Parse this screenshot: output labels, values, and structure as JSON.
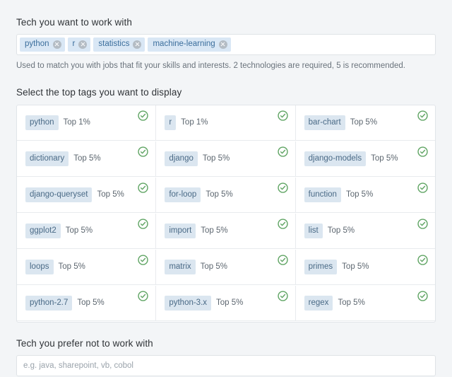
{
  "work_with": {
    "title": "Tech you want to work with",
    "pills": [
      "python",
      "r",
      "statistics",
      "machine-learning"
    ],
    "helper": "Used to match you with jobs that fit your skills and interests. 2 technologies are required, 5 is recommended."
  },
  "top_tags": {
    "title": "Select the top tags you want to display",
    "checkmark_color": "#5fa463",
    "cells": [
      {
        "tag": "python",
        "rank": "Top 1%",
        "selected": true
      },
      {
        "tag": "r",
        "rank": "Top 1%",
        "selected": true
      },
      {
        "tag": "bar-chart",
        "rank": "Top 5%",
        "selected": true
      },
      {
        "tag": "dictionary",
        "rank": "Top 5%",
        "selected": true
      },
      {
        "tag": "django",
        "rank": "Top 5%",
        "selected": true
      },
      {
        "tag": "django-models",
        "rank": "Top 5%",
        "selected": true
      },
      {
        "tag": "django-queryset",
        "rank": "Top 5%",
        "selected": true
      },
      {
        "tag": "for-loop",
        "rank": "Top 5%",
        "selected": true
      },
      {
        "tag": "function",
        "rank": "Top 5%",
        "selected": true
      },
      {
        "tag": "ggplot2",
        "rank": "Top 5%",
        "selected": true
      },
      {
        "tag": "import",
        "rank": "Top 5%",
        "selected": true
      },
      {
        "tag": "list",
        "rank": "Top 5%",
        "selected": true
      },
      {
        "tag": "loops",
        "rank": "Top 5%",
        "selected": true
      },
      {
        "tag": "matrix",
        "rank": "Top 5%",
        "selected": true
      },
      {
        "tag": "primes",
        "rank": "Top 5%",
        "selected": true
      },
      {
        "tag": "python-2.7",
        "rank": "Top 5%",
        "selected": true
      },
      {
        "tag": "python-3.x",
        "rank": "Top 5%",
        "selected": true
      },
      {
        "tag": "regex",
        "rank": "Top 5%",
        "selected": true
      }
    ]
  },
  "avoid": {
    "title": "Tech you prefer not to work with",
    "placeholder": "e.g. java, sharepoint, vb, cobol"
  },
  "colors": {
    "page_background": "#f3f5f7",
    "pill_background": "#d9e7f5",
    "pill_text": "#3b6e9c",
    "check_green": "#5fa463"
  }
}
